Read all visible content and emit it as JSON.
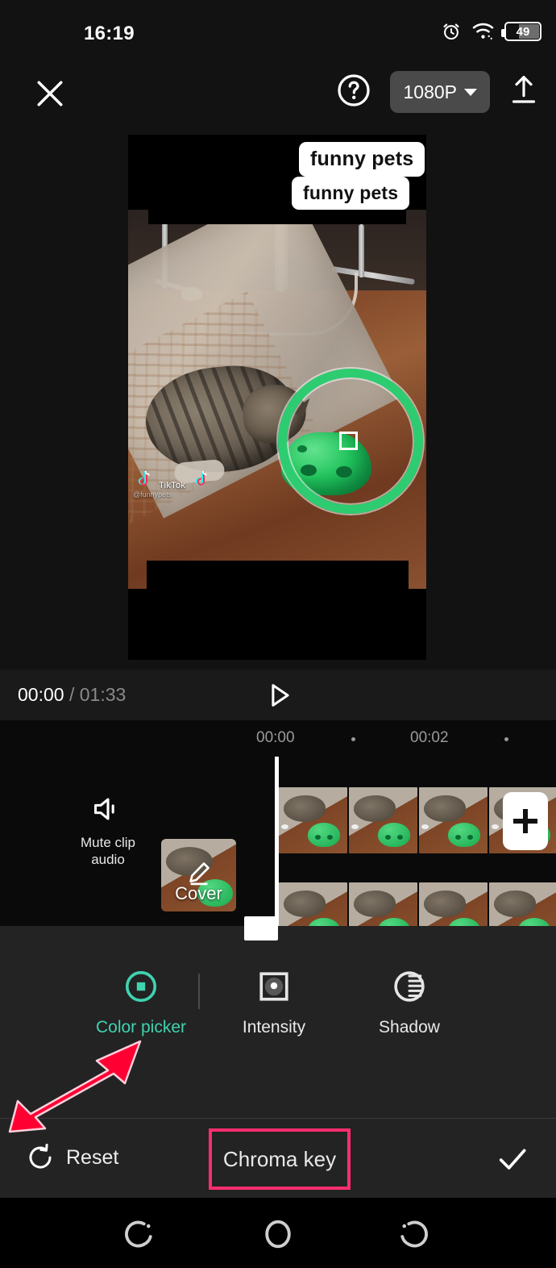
{
  "status_bar": {
    "time": "16:19",
    "battery_level": "49",
    "icons": [
      "alarm-icon",
      "wifi-icon",
      "battery-icon"
    ]
  },
  "toolbar": {
    "close_label": "close-icon",
    "help_label": "help-icon",
    "resolution": "1080P",
    "export_label": "export-icon"
  },
  "preview": {
    "stickers": [
      "funny pets",
      "funny pets"
    ],
    "watermark": "TikTok",
    "watermark_user": "@funnypets",
    "picker_ring_color": "#2ecc71"
  },
  "playback": {
    "current_time": "00:00",
    "separator": "/",
    "total_time": "01:33",
    "play_label": "play-icon"
  },
  "timeline": {
    "ruler_labels": [
      "00:00",
      "00:02"
    ],
    "mute_label_line1": "Mute clip",
    "mute_label_line2": "audio",
    "cover_label": "Cover",
    "add_label": "+"
  },
  "options": {
    "items": [
      {
        "label": "Color picker",
        "icon": "color-picker-icon",
        "active": true
      },
      {
        "label": "Intensity",
        "icon": "intensity-icon",
        "active": false
      },
      {
        "label": "Shadow",
        "icon": "shadow-icon",
        "active": false
      }
    ],
    "active_color": "#3fd3b0"
  },
  "bottom_bar": {
    "reset_label": "Reset",
    "title": "Chroma key",
    "confirm_label": "check-icon",
    "highlight_color": "#ff2d6f"
  },
  "nav_bar": {
    "recents_label": "recents-icon",
    "home_label": "home-icon",
    "back_label": "back-icon"
  },
  "annotations": {
    "arrow_color": "#ff0033",
    "arrow_target": "Color picker"
  }
}
